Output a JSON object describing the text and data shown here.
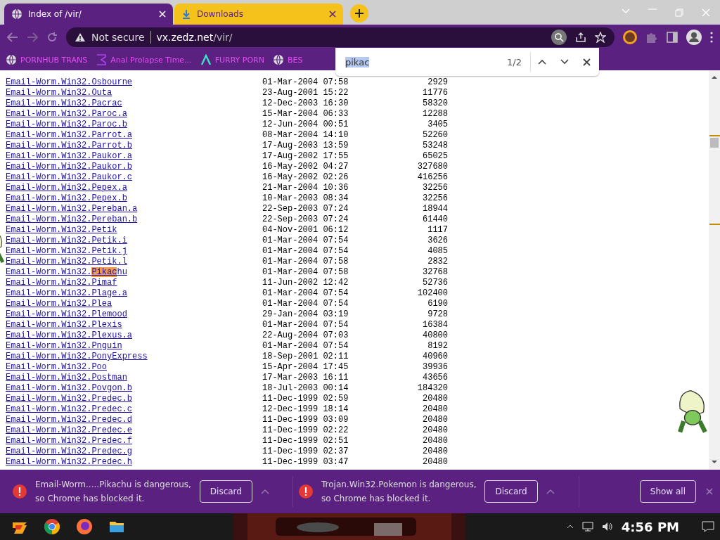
{
  "tabs": [
    {
      "title": "Index of /vir/",
      "selected": true,
      "kind": "page"
    },
    {
      "title": "Downloads",
      "selected": false,
      "kind": "download"
    }
  ],
  "address_bar": {
    "security": "Not secure",
    "host": "vx.zedz.net",
    "path": "/vir/"
  },
  "bookmarks": [
    {
      "label": "PORNHUB TRANS",
      "kind": "globe"
    },
    {
      "label": "Anal Prolapse Time...",
      "kind": "sigma"
    },
    {
      "label": "FURRY PORN",
      "kind": "lambda"
    },
    {
      "label": "BES",
      "kind": "globe"
    }
  ],
  "find_bar": {
    "query": "pikac",
    "count": "1/2"
  },
  "listing": [
    {
      "name": "Email-Worm.Win32.Osbourne",
      "date": "01-Mar-2004 07:58",
      "size": "2929"
    },
    {
      "name": "Email-Worm.Win32.Outa",
      "date": "23-Aug-2001 15:22",
      "size": "11776"
    },
    {
      "name": "Email-Worm.Win32.Pacrac",
      "date": "12-Dec-2003 16:30",
      "size": "58320"
    },
    {
      "name": "Email-Worm.Win32.Paroc.a",
      "date": "15-Mar-2004 06:33",
      "size": "12288"
    },
    {
      "name": "Email-Worm.Win32.Paroc.b",
      "date": "12-Jun-2004 00:51",
      "size": "3405"
    },
    {
      "name": "Email-Worm.Win32.Parrot.a",
      "date": "08-Mar-2004 14:10",
      "size": "52260"
    },
    {
      "name": "Email-Worm.Win32.Parrot.b",
      "date": "17-Aug-2003 13:59",
      "size": "53248"
    },
    {
      "name": "Email-Worm.Win32.Paukor.a",
      "date": "17-Aug-2002 17:55",
      "size": "65025"
    },
    {
      "name": "Email-Worm.Win32.Paukor.b",
      "date": "16-May-2002 04:27",
      "size": "327680"
    },
    {
      "name": "Email-Worm.Win32.Paukor.c",
      "date": "16-May-2002 02:26",
      "size": "416256"
    },
    {
      "name": "Email-Worm.Win32.Pepex.a",
      "date": "21-Mar-2004 10:36",
      "size": "32256"
    },
    {
      "name": "Email-Worm.Win32.Pepex.b",
      "date": "10-Mar-2003 08:34",
      "size": "32256"
    },
    {
      "name": "Email-Worm.Win32.Pereban.a",
      "date": "22-Sep-2003 07:24",
      "size": "18944"
    },
    {
      "name": "Email-Worm.Win32.Pereban.b",
      "date": "22-Sep-2003 07:24",
      "size": "61440"
    },
    {
      "name": "Email-Worm.Win32.Petik",
      "date": "04-Nov-2001 06:12",
      "size": "1117"
    },
    {
      "name": "Email-Worm.Win32.Petik.i",
      "date": "01-Mar-2004 07:54",
      "size": "3626"
    },
    {
      "name": "Email-Worm.Win32.Petik.j",
      "date": "01-Mar-2004 07:54",
      "size": "4085"
    },
    {
      "name": "Email-Worm.Win32.Petik.l",
      "date": "01-Mar-2004 07:58",
      "size": "2832"
    },
    {
      "name_parts": [
        {
          "text": "Email-Worm.Win32.",
          "highlighted": false
        },
        {
          "text": "Pikac",
          "highlighted": true
        },
        {
          "text": "hu",
          "highlighted": false
        }
      ],
      "date": "01-Mar-2004 07:58",
      "size": "32768"
    },
    {
      "name": "Email-Worm.Win32.Pimaf",
      "date": "11-Jun-2002 12:42",
      "size": "52736"
    },
    {
      "name": "Email-Worm.Win32.Plage.a",
      "date": "01-Mar-2004 07:54",
      "size": "102400"
    },
    {
      "name": "Email-Worm.Win32.Plea",
      "date": "01-Mar-2004 07:54",
      "size": "6190"
    },
    {
      "name": "Email-Worm.Win32.Plemood",
      "date": "29-Jan-2004 03:19",
      "size": "9728"
    },
    {
      "name": "Email-Worm.Win32.Plexis",
      "date": "01-Mar-2004 07:54",
      "size": "16384"
    },
    {
      "name": "Email-Worm.Win32.Plexus.a",
      "date": "22-Aug-2004 07:03",
      "size": "40800"
    },
    {
      "name": "Email-Worm.Win32.Pnguin",
      "date": "01-Mar-2004 07:54",
      "size": "8192"
    },
    {
      "name": "Email-Worm.Win32.PonyExpress",
      "date": "18-Sep-2001 02:11",
      "size": "40960"
    },
    {
      "name": "Email-Worm.Win32.Poo",
      "date": "15-Apr-2004 17:45",
      "size": "39936"
    },
    {
      "name": "Email-Worm.Win32.Postman",
      "date": "17-Mar-2003 16:11",
      "size": "43656"
    },
    {
      "name": "Email-Worm.Win32.Povgon.b",
      "date": "18-Jul-2003 00:14",
      "size": "184320"
    },
    {
      "name": "Email-Worm.Win32.Predec.b",
      "date": "11-Dec-1999 02:59",
      "size": "20480"
    },
    {
      "name": "Email-Worm.Win32.Predec.c",
      "date": "12-Dec-1999 18:14",
      "size": "20480"
    },
    {
      "name": "Email-Worm.Win32.Predec.d",
      "date": "11-Dec-1999 03:09",
      "size": "20480"
    },
    {
      "name": "Email-Worm.Win32.Predec.e",
      "date": "11-Dec-1999 02:22",
      "size": "20480"
    },
    {
      "name": "Email-Worm.Win32.Predec.f",
      "date": "11-Dec-1999 02:51",
      "size": "20480"
    },
    {
      "name": "Email-Worm.Win32.Predec.g",
      "date": "11-Dec-1999 02:37",
      "size": "20480"
    },
    {
      "name": "Email-Worm.Win32.Predec.h",
      "date": "11-Dec-1999 03:47",
      "size": "20480"
    }
  ],
  "downloads": [
    {
      "line1": "Email-Worm.....Pikachu is dangerous,",
      "line2": "so Chrome has blocked it.",
      "button": "Discard"
    },
    {
      "line1": "Trojan.Win32.Pokemon is dangerous,",
      "line2": "so Chrome has blocked it.",
      "button": "Discard"
    }
  ],
  "show_all": "Show all",
  "taskbar": {
    "apps": [
      {
        "kind": "logo"
      },
      {
        "kind": "chrome"
      },
      {
        "kind": "firefox"
      },
      {
        "kind": "folder"
      }
    ],
    "time": "4:56 PM"
  }
}
